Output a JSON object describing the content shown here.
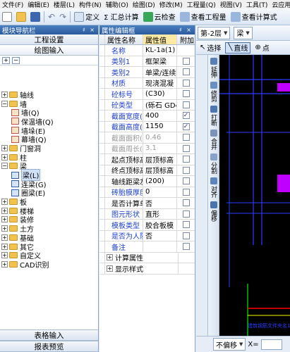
{
  "menu": [
    "文件(F)",
    "编辑(E)",
    "楼层(L)",
    "构件(N)",
    "辅助(O)",
    "绘图(D)",
    "修改(M)",
    "工程量(Q)",
    "视图(V)",
    "工具(T)",
    "云应用"
  ],
  "toolbar": {
    "define": "定义",
    "sum_calc": "Σ 汇总计算",
    "cloud_check": "云检查",
    "view_qty": "查看工程量",
    "view_formula": "查看计算式",
    "floor_combo": "第-2层",
    "element_combo": "梁",
    "select": "选择",
    "line": "直线",
    "point": "点"
  },
  "nav": {
    "title": "模块导航栏",
    "controls": "♯ ×",
    "top_buttons": [
      "工程设置",
      "绘图输入"
    ],
    "tree": [
      {
        "level": 0,
        "toggle": "+",
        "kind": "folder",
        "label": "轴线"
      },
      {
        "level": 0,
        "toggle": "−",
        "kind": "folder",
        "label": "墙"
      },
      {
        "level": 1,
        "toggle": "",
        "kind": "leaf",
        "label": "墙(Q)"
      },
      {
        "level": 1,
        "toggle": "",
        "kind": "leaf",
        "label": "保温墙(Q)"
      },
      {
        "level": 1,
        "toggle": "",
        "kind": "leaf",
        "label": "墙垛(E)"
      },
      {
        "level": 1,
        "toggle": "",
        "kind": "leaf",
        "label": "幕墙(Q)"
      },
      {
        "level": 0,
        "toggle": "+",
        "kind": "folder",
        "label": "门窗洞"
      },
      {
        "level": 0,
        "toggle": "+",
        "kind": "folder",
        "label": "柱"
      },
      {
        "level": 0,
        "toggle": "−",
        "kind": "folder",
        "label": "梁"
      },
      {
        "level": 1,
        "toggle": "",
        "kind": "leaf-blue",
        "label": "梁(L)",
        "selected": true
      },
      {
        "level": 1,
        "toggle": "",
        "kind": "leaf-blue",
        "label": "连梁(G)"
      },
      {
        "level": 1,
        "toggle": "",
        "kind": "leaf-blue",
        "label": "圈梁(E)"
      },
      {
        "level": 0,
        "toggle": "+",
        "kind": "folder",
        "label": "板"
      },
      {
        "level": 0,
        "toggle": "+",
        "kind": "folder",
        "label": "楼梯"
      },
      {
        "level": 0,
        "toggle": "+",
        "kind": "folder",
        "label": "装修"
      },
      {
        "level": 0,
        "toggle": "+",
        "kind": "folder",
        "label": "土方"
      },
      {
        "level": 0,
        "toggle": "+",
        "kind": "folder",
        "label": "基础"
      },
      {
        "level": 0,
        "toggle": "+",
        "kind": "folder",
        "label": "其它"
      },
      {
        "level": 0,
        "toggle": "+",
        "kind": "folder",
        "label": "自定义"
      },
      {
        "level": 0,
        "toggle": "+",
        "kind": "folder",
        "label": "CAD识别"
      }
    ],
    "bottom_buttons": [
      "表格输入",
      "报表预览"
    ]
  },
  "prop": {
    "title": "属性编辑框",
    "controls": "♯ ×",
    "headers": {
      "name": "属性名称",
      "value": "属性值",
      "attach": "附加"
    },
    "rows": [
      {
        "idx": "1",
        "name": "名称",
        "value": "KL-1a(1)",
        "style": "blue",
        "checkbox": false,
        "checked": false
      },
      {
        "idx": "2",
        "name": "类别1",
        "value": "框架梁",
        "style": "blue",
        "checkbox": true,
        "checked": false
      },
      {
        "idx": "3",
        "name": "类别2",
        "value": "单梁/连续",
        "style": "blue",
        "checkbox": true,
        "checked": false
      },
      {
        "idx": "4",
        "name": "材质",
        "value": "现浇混凝",
        "style": "blue",
        "checkbox": true,
        "checked": false
      },
      {
        "idx": "5",
        "name": "砼标号",
        "value": "(C30)",
        "style": "blue",
        "checkbox": true,
        "checked": false
      },
      {
        "idx": "6",
        "name": "砼类型",
        "value": "(砾石 GD4",
        "style": "blue",
        "checkbox": true,
        "checked": false
      },
      {
        "idx": "7",
        "name": "截面宽度(",
        "value": "400",
        "style": "blue",
        "checkbox": true,
        "checked": true
      },
      {
        "idx": "8",
        "name": "截面高度(",
        "value": "1150",
        "style": "blue",
        "checkbox": true,
        "checked": true
      },
      {
        "idx": "9",
        "name": "截面面积(m",
        "value": "0.46",
        "style": "gray",
        "checkbox": true,
        "checked": false
      },
      {
        "idx": "10",
        "name": "截面周长(m",
        "value": "3.1",
        "style": "gray",
        "checkbox": true,
        "checked": false
      },
      {
        "idx": "11",
        "name": "起点顶标高",
        "value": "层顶标高",
        "style": "normal",
        "checkbox": true,
        "checked": false
      },
      {
        "idx": "12",
        "name": "终点顶标高",
        "value": "层顶标高",
        "style": "normal",
        "checkbox": true,
        "checked": false
      },
      {
        "idx": "13",
        "name": "轴线距梁左",
        "value": "(200)",
        "style": "normal",
        "checkbox": true,
        "checked": false
      },
      {
        "idx": "14",
        "name": "砖胎膜厚度",
        "value": "0",
        "style": "blue",
        "checkbox": true,
        "checked": false
      },
      {
        "idx": "15",
        "name": "是否计算单",
        "value": "否",
        "style": "normal",
        "checkbox": true,
        "checked": false
      },
      {
        "idx": "16",
        "name": "图元形状",
        "value": "直形",
        "style": "blue",
        "checkbox": true,
        "checked": false
      },
      {
        "idx": "17",
        "name": "模板类型",
        "value": "胶合板模",
        "style": "blue",
        "checkbox": true,
        "checked": false
      },
      {
        "idx": "18",
        "name": "是否为人防",
        "value": "否",
        "style": "blue",
        "checkbox": true,
        "checked": false
      },
      {
        "idx": "19",
        "name": "备注",
        "value": "",
        "style": "blue",
        "checkbox": true,
        "checked": false
      }
    ],
    "groups": [
      {
        "idx": "20",
        "label": "计算属性"
      },
      {
        "idx": "35",
        "label": "显示样式"
      }
    ]
  },
  "side_tools": [
    "延伸",
    "修剪",
    "打断",
    "合并",
    "分割",
    "对齐",
    "偏移"
  ],
  "canvas_text": "建筑钢筋文件夹名1 5/5",
  "status": {
    "mode": "不偏移",
    "x_label": "X="
  },
  "colors": {
    "canvas_bg": "#000000",
    "beam_blue": "#2b3cff",
    "accent_purple": "#c000ff",
    "axis_green": "#00c000",
    "axis_red": "#ff0000",
    "selected_yellow": "#ffff00"
  }
}
